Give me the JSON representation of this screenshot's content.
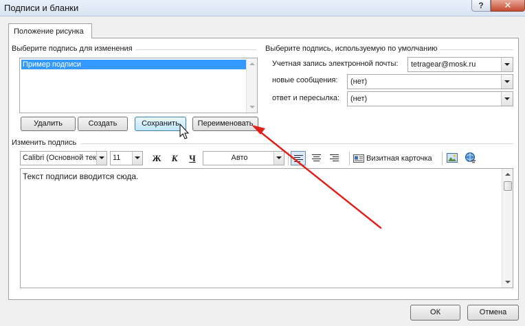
{
  "window": {
    "title": "Подписи и бланки",
    "help_glyph": "?",
    "close_glyph": "✕"
  },
  "tabs": [
    {
      "label": "Положение рисунка"
    }
  ],
  "select_signature": {
    "label": "Выберите подпись для изменения",
    "items": [
      "Пример подписи"
    ],
    "selected_index": 0
  },
  "default_signature": {
    "label": "Выберите подпись, используемую по умолчанию",
    "email_label": "Учетная запись электронной почты:",
    "email_value": "tetragear@mosk.ru",
    "new_messages_label": "новые сообщения:",
    "new_messages_value": "(нет)",
    "replies_label": "ответ и пересылка:",
    "replies_value": "(нет)"
  },
  "signature_buttons": {
    "delete": "Удалить",
    "create": "Создать",
    "save": "Сохранить",
    "rename": "Переименовать"
  },
  "edit_signature": {
    "label": "Изменить подпись",
    "font": "Calibri (Основной текст)",
    "size": "11",
    "bold": "Ж",
    "italic": "К",
    "underline": "Ч",
    "color": "Авто",
    "business_card": "Визитная карточка",
    "body_text": "Текст подписи вводится сюда."
  },
  "footer": {
    "ok": "ОК",
    "cancel": "Отмена"
  },
  "colors": {
    "annotation_arrow": "#e0201a",
    "selection": "#3399ff"
  },
  "icons": [
    "help-icon",
    "close-icon",
    "align-left-icon",
    "align-center-icon",
    "align-right-icon",
    "business-card-icon",
    "insert-picture-icon",
    "hyperlink-icon",
    "mouse-cursor-icon",
    "annotation-arrow"
  ]
}
